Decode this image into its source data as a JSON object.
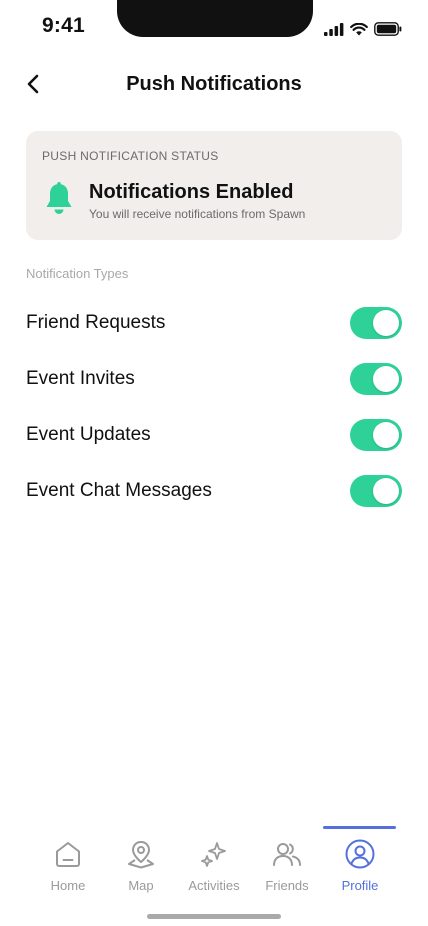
{
  "status_bar": {
    "time": "9:41"
  },
  "header": {
    "title": "Push Notifications"
  },
  "status_card": {
    "caption": "PUSH NOTIFICATION STATUS",
    "title": "Notifications Enabled",
    "subtitle": "You will receive notifications from Spawn",
    "icon": "bell-icon",
    "icon_color": "#2ed197"
  },
  "section_label": "Notification Types",
  "toggles": [
    {
      "label": "Friend Requests",
      "on": true
    },
    {
      "label": "Event Invites",
      "on": true
    },
    {
      "label": "Event Updates",
      "on": true
    },
    {
      "label": "Event Chat Messages",
      "on": true
    }
  ],
  "toggle_on_color": "#2ed197",
  "tabs": [
    {
      "label": "Home",
      "icon": "home-icon",
      "active": false
    },
    {
      "label": "Map",
      "icon": "map-pin-icon",
      "active": false
    },
    {
      "label": "Activities",
      "icon": "sparkles-icon",
      "active": false
    },
    {
      "label": "Friends",
      "icon": "friends-icon",
      "active": false
    },
    {
      "label": "Profile",
      "icon": "profile-icon",
      "active": true
    }
  ],
  "accent_color": "#5570dc"
}
